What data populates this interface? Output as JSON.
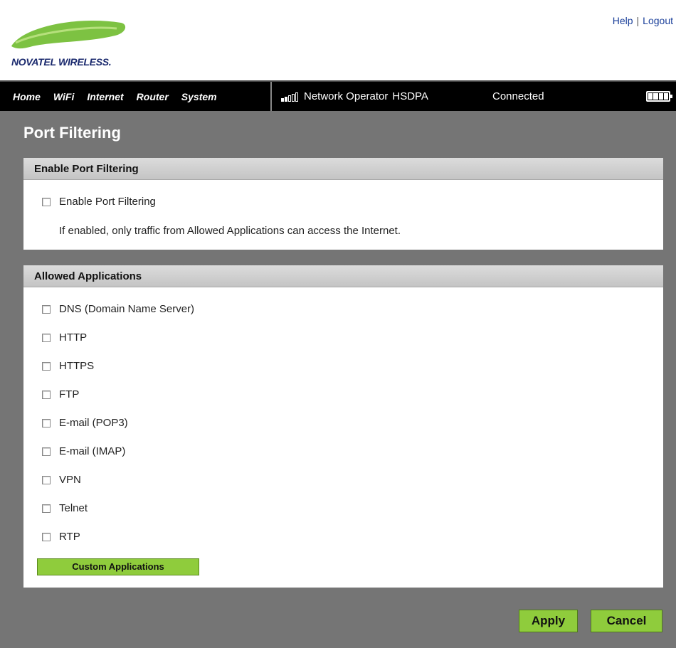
{
  "header": {
    "logo_text": "NOVATEL WIRELESS.",
    "help_label": "Help",
    "separator": "|",
    "logout_label": "Logout"
  },
  "nav": {
    "items": [
      "Home",
      "WiFi",
      "Internet",
      "Router",
      "System"
    ]
  },
  "status": {
    "signal_icon": "signal-bars-icon",
    "signal_bars_filled": 2,
    "signal_bars_total": 5,
    "operator": "Network Operator",
    "network_type": "HSDPA",
    "connection": "Connected",
    "battery_icon": "battery-icon",
    "battery_level": "full"
  },
  "page": {
    "title": "Port Filtering"
  },
  "enable_panel": {
    "heading": "Enable Port Filtering",
    "checkbox_label": "Enable Port Filtering",
    "checked": false,
    "description": "If enabled, only traffic from Allowed Applications can access the Internet."
  },
  "apps_panel": {
    "heading": "Allowed Applications",
    "apps": [
      {
        "label": "DNS (Domain Name Server)",
        "checked": false
      },
      {
        "label": "HTTP",
        "checked": false
      },
      {
        "label": "HTTPS",
        "checked": false
      },
      {
        "label": "FTP",
        "checked": false
      },
      {
        "label": "E-mail (POP3)",
        "checked": false
      },
      {
        "label": "E-mail (IMAP)",
        "checked": false
      },
      {
        "label": "VPN",
        "checked": false
      },
      {
        "label": "Telnet",
        "checked": false
      },
      {
        "label": "RTP",
        "checked": false
      }
    ],
    "custom_button": "Custom Applications"
  },
  "actions": {
    "apply": "Apply",
    "cancel": "Cancel"
  },
  "colors": {
    "accent_green": "#8fcc3c",
    "main_bg": "#757575",
    "nav_bg": "#000000",
    "logo_swoosh": "#7dc242",
    "logo_text": "#1b2a6e",
    "link": "#1a3f9a"
  }
}
